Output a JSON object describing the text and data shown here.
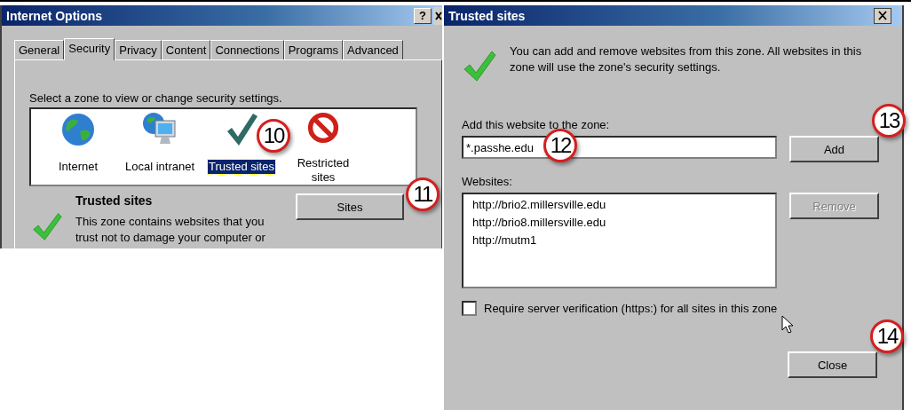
{
  "internet_options": {
    "title": "Internet Options",
    "help_button": "?",
    "tabs": [
      {
        "label": "General",
        "selected": false
      },
      {
        "label": "Security",
        "selected": true
      },
      {
        "label": "Privacy",
        "selected": false
      },
      {
        "label": "Content",
        "selected": false
      },
      {
        "label": "Connections",
        "selected": false
      },
      {
        "label": "Programs",
        "selected": false
      },
      {
        "label": "Advanced",
        "selected": false
      }
    ],
    "zone_prompt": "Select a zone to view or change security settings.",
    "zones": [
      {
        "label": "Internet",
        "kind": "globe",
        "selected": false
      },
      {
        "label": "Local intranet",
        "kind": "intranet",
        "selected": false
      },
      {
        "label": "Trusted sites",
        "kind": "trusted",
        "selected": true,
        "callout": "10"
      },
      {
        "label": "Restricted sites",
        "kind": "restricted",
        "selected": false
      }
    ],
    "zone_name": "Trusted sites",
    "zone_description": "This zone contains websites that you trust not to damage your computer or",
    "sites_button": {
      "label": "Sites",
      "callout": "11"
    }
  },
  "trusted_sites": {
    "title": "Trusted sites",
    "intro": "You can add and remove websites from this zone. All websites in this zone will use the zone's security settings.",
    "add_label": "Add this website to the zone:",
    "website_input": {
      "value": "*.passhe.edu",
      "callout": "12"
    },
    "add_button": {
      "label": "Add",
      "disabled": false,
      "callout": "13"
    },
    "websites_label": "Websites:",
    "websites": [
      {
        "url": "http://brio2.millersville.edu",
        "selected": false
      },
      {
        "url": "http://brio8.millersville.edu",
        "selected": false
      },
      {
        "url": "http://mutm1",
        "selected": false
      }
    ],
    "remove_button": {
      "label": "Remove",
      "disabled": true
    },
    "require_https": {
      "label": "Require server verification (https:) for all sites in this zone",
      "checked": false
    },
    "close_button": {
      "label": "Close",
      "disabled": false,
      "callout": "14"
    }
  }
}
